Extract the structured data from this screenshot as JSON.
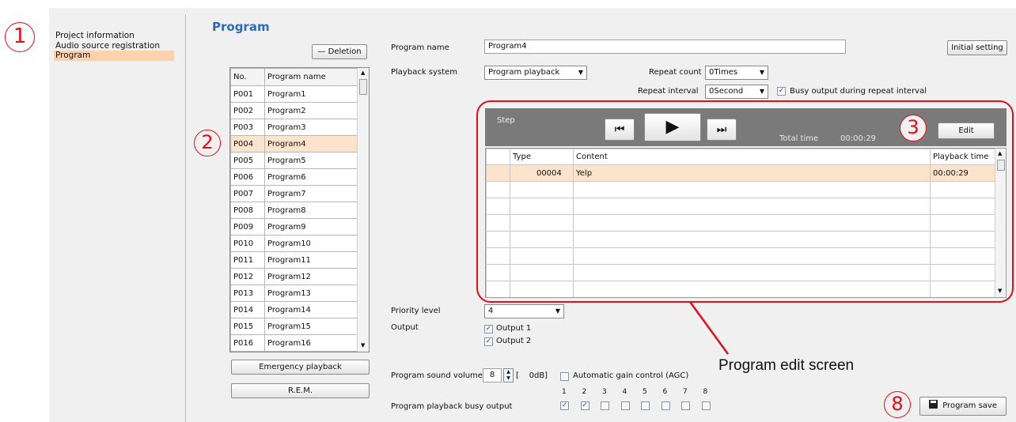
{
  "sidebar": {
    "items": [
      {
        "label": "Project information"
      },
      {
        "label": "Audio source registration"
      },
      {
        "label": "Program"
      }
    ]
  },
  "page_title": "Program",
  "callouts": {
    "c1": "1",
    "c2": "2",
    "c3": "3",
    "c8": "8"
  },
  "program_list": {
    "deletion_label": "Deletion",
    "headers": [
      "No.",
      "Program name"
    ],
    "rows": [
      [
        "P001",
        "Program1"
      ],
      [
        "P002",
        "Program2"
      ],
      [
        "P003",
        "Program3"
      ],
      [
        "P004",
        "Program4"
      ],
      [
        "P005",
        "Program5"
      ],
      [
        "P006",
        "Program6"
      ],
      [
        "P007",
        "Program7"
      ],
      [
        "P008",
        "Program8"
      ],
      [
        "P009",
        "Program9"
      ],
      [
        "P010",
        "Program10"
      ],
      [
        "P011",
        "Program11"
      ],
      [
        "P012",
        "Program12"
      ],
      [
        "P013",
        "Program13"
      ],
      [
        "P014",
        "Program14"
      ],
      [
        "P015",
        "Program15"
      ],
      [
        "P016",
        "Program16"
      ]
    ],
    "selected_row": 3,
    "emergency_label": "Emergency playback",
    "rem_label": "R.E.M."
  },
  "form": {
    "program_name_label": "Program name",
    "program_name_value": "Program4",
    "initial_setting_label": "Initial setting",
    "playback_system_label": "Playback system",
    "playback_system_value": "Program playback",
    "repeat_count_label": "Repeat count",
    "repeat_count_value": "0Times",
    "repeat_interval_label": "Repeat interval",
    "repeat_interval_value": "0Second",
    "busy_output_label": "Busy output during repeat interval",
    "busy_output_checked": true
  },
  "step": {
    "label": "Step",
    "total_time_label": "Total time",
    "total_time_value": "00:00:29",
    "edit_label": "Edit",
    "headers": [
      "Type",
      "Content",
      "Playback time"
    ],
    "rows": [
      [
        "00004",
        "Yelp",
        "00:00:29"
      ]
    ]
  },
  "annotation": "Program edit screen",
  "priority": {
    "label": "Priority level",
    "value": "4"
  },
  "output": {
    "label": "Output",
    "items": [
      "Output 1",
      "Output 2"
    ]
  },
  "volume": {
    "label": "Program sound volume",
    "value": "8",
    "db_text": "[    0dB]",
    "agc_label": "Automatic gain control (AGC)"
  },
  "busy": {
    "label": "Program playback busy output",
    "numbers": [
      "1",
      "2",
      "3",
      "4",
      "5",
      "6",
      "7",
      "8"
    ],
    "checked": [
      true,
      true,
      false,
      false,
      false,
      false,
      false,
      false
    ]
  },
  "save_label": "Program save",
  "colors": {
    "accent_blue": "#2b6cb8",
    "highlight": "#fde3cc",
    "callout_red": "#e0101a",
    "step_bar": "#7a7a7a"
  }
}
